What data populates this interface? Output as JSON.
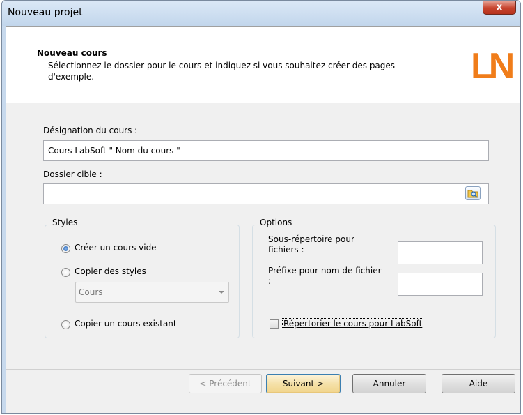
{
  "window": {
    "title": "Nouveau projet",
    "close_glyph": "x"
  },
  "header": {
    "title": "Nouveau cours",
    "description": "Sélectionnez le dossier pour le cours et indiquez si vous souhaitez créer des pages d'exemple.",
    "logo_text": "LN",
    "logo_color": "#f07d1a"
  },
  "form": {
    "course_label": "Désignation du cours :",
    "course_value": "Cours LabSoft \" Nom du cours \"",
    "folder_label": "Dossier cible :",
    "folder_value": "",
    "browse_icon": "folder-browse-icon"
  },
  "styles": {
    "title": "Styles",
    "options": [
      {
        "label": "Créer un cours vide",
        "checked": true
      },
      {
        "label": "Copier des styles",
        "checked": false
      },
      {
        "label": "Copier un cours existant",
        "checked": false
      }
    ],
    "combo_value": "Cours"
  },
  "options": {
    "title": "Options",
    "subdir_label": "Sous-répertoire pour fichiers :",
    "subdir_value": "",
    "prefix_label": "Préfixe pour nom de fichier :",
    "prefix_value": "",
    "register_label": "Répertorier le cours pour LabSoft",
    "register_checked": false
  },
  "buttons": {
    "back": "< Précédent",
    "next": "Suivant >",
    "cancel": "Annuler",
    "help": "Aide"
  }
}
